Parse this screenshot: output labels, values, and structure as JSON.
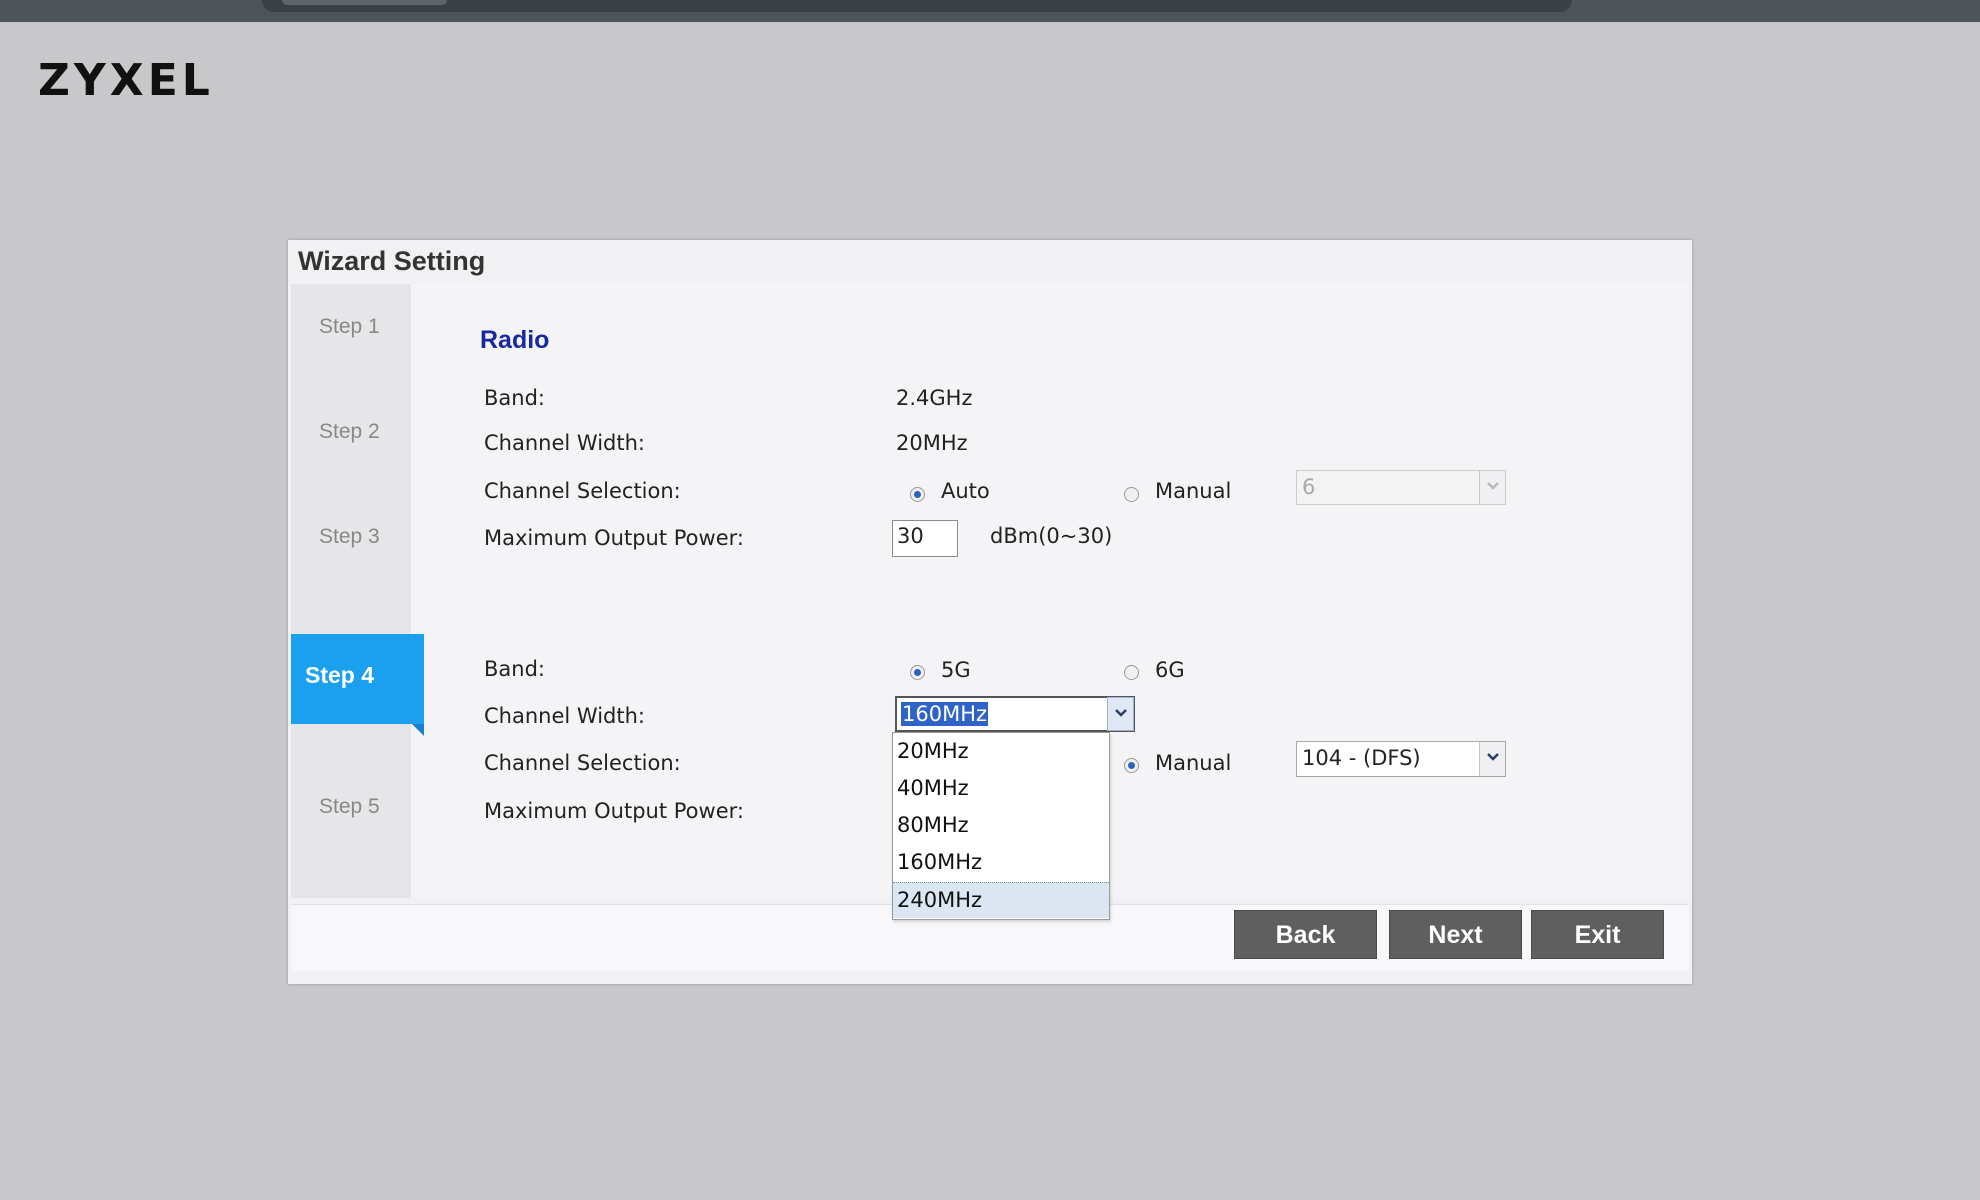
{
  "brand": {
    "logo": "ZYXEL"
  },
  "dialog": {
    "title": "Wizard Setting"
  },
  "steps": [
    {
      "label": "Step 1"
    },
    {
      "label": "Step 2"
    },
    {
      "label": "Step 3"
    },
    {
      "label": "Step 4",
      "active": true
    },
    {
      "label": "Step 5"
    }
  ],
  "section": {
    "title": "Radio"
  },
  "radio24": {
    "band_label": "Band:",
    "band_value": "2.4GHz",
    "channel_width_label": "Channel Width:",
    "channel_width_value": "20MHz",
    "channel_selection_label": "Channel Selection:",
    "auto_label": "Auto",
    "manual_label": "Manual",
    "selected_mode": "Auto",
    "channel_select_value": "6",
    "max_power_label": "Maximum Output Power:",
    "max_power_value": "30",
    "max_power_unit": "dBm(0~30)"
  },
  "radio5": {
    "band_label": "Band:",
    "band_option_5g": "5G",
    "band_option_6g": "6G",
    "selected_band": "5G",
    "channel_width_label": "Channel Width:",
    "channel_width_value": "160MHz",
    "channel_width_options": [
      "20MHz",
      "40MHz",
      "80MHz",
      "160MHz",
      "240MHz"
    ],
    "hovered_option": "240MHz",
    "channel_selection_label": "Channel Selection:",
    "manual_label": "Manual",
    "selected_mode": "Manual",
    "channel_select_value": "104 - (DFS)",
    "max_power_label": "Maximum Output Power:"
  },
  "buttons": {
    "back": "Back",
    "next": "Next",
    "exit": "Exit"
  },
  "colors": {
    "accent": "#1aa0ef",
    "section_title": "#1828a0",
    "button": "#5f5f5f",
    "selection": "#2f63c8"
  },
  "icons": {
    "dropdown_arrow": "chevron-down-icon"
  }
}
